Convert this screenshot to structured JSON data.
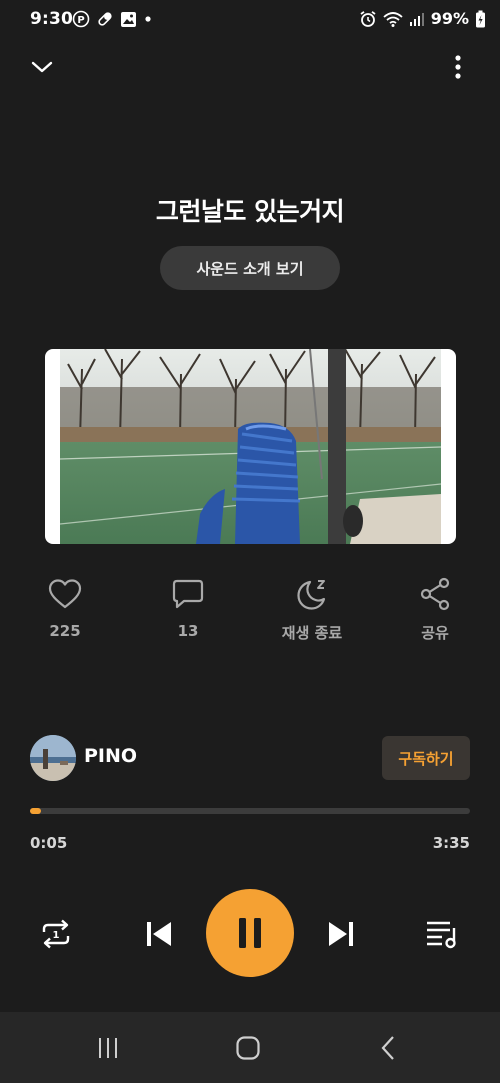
{
  "status_bar": {
    "time": "9:30",
    "battery": "99%",
    "left_icons": [
      "parking-icon",
      "pill-icon",
      "gallery-icon",
      "dot-icon"
    ],
    "right_icons": [
      "alarm-icon",
      "wifi-icon",
      "signal-icon",
      "battery-icon"
    ]
  },
  "top_bar": {
    "collapse_icon": "chevron-down-icon",
    "more_icon": "more-vertical-icon"
  },
  "track": {
    "title": "그런날도 있는거지",
    "sound_intro_label": "사운드 소개 보기"
  },
  "actions": [
    {
      "icon": "heart-icon",
      "label": "225"
    },
    {
      "icon": "comment-icon",
      "label": "13"
    },
    {
      "icon": "sleep-timer-icon",
      "label": "재생 종료"
    },
    {
      "icon": "share-icon",
      "label": "공유"
    }
  ],
  "artist": {
    "name": "PINO",
    "subscribe_label": "구독하기"
  },
  "playback": {
    "current_time": "0:05",
    "total_time": "3:35",
    "progress": 0.024
  },
  "controls": {
    "repeat_icon": "repeat-one-icon",
    "prev_icon": "skip-previous-icon",
    "play_state": "pause-icon",
    "next_icon": "skip-next-icon",
    "playlist_icon": "playlist-icon"
  },
  "nav_bar": [
    "recent-apps-icon",
    "home-icon",
    "back-icon"
  ],
  "colors": {
    "background": "#1c1c1c",
    "accent": "#f5a133",
    "secondary_text": "#a9a9a9",
    "button_bg": "#3a3a3a"
  }
}
